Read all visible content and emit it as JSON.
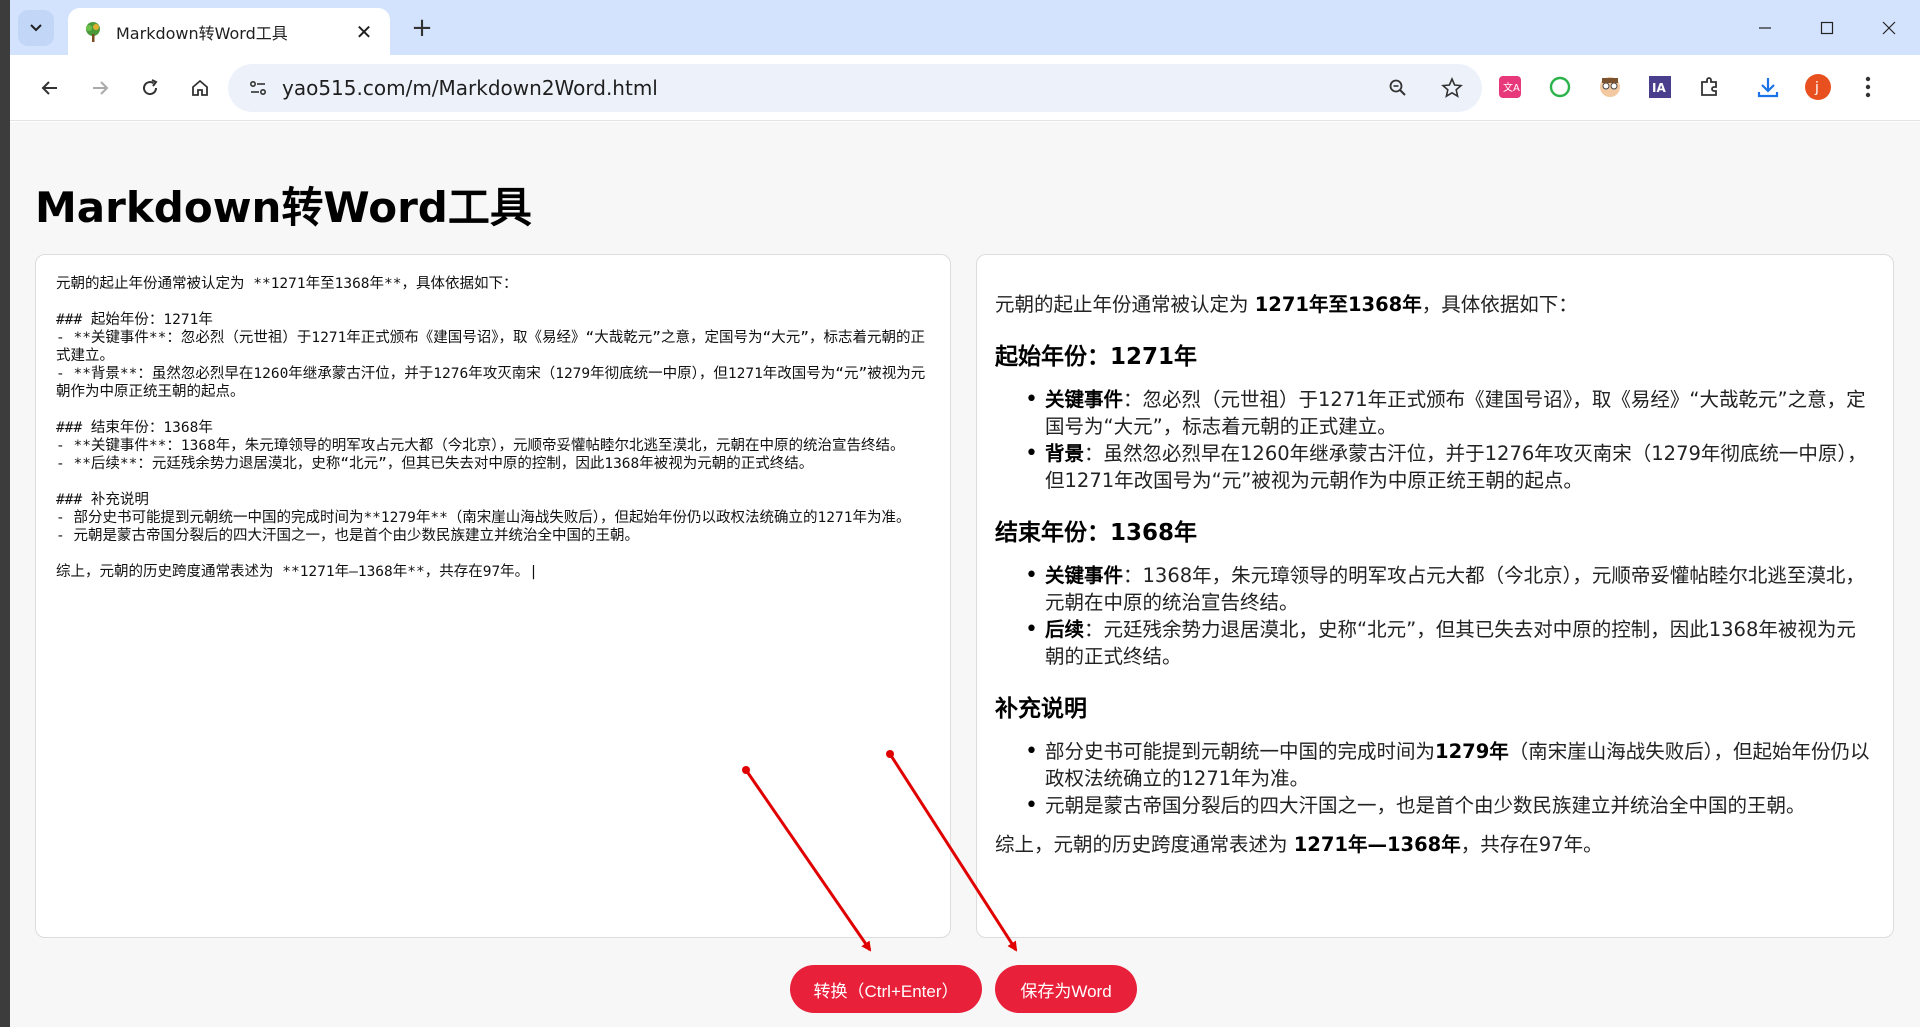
{
  "browser": {
    "tab_title": "Markdown转Word工具",
    "url": "yao515.com/m/Markdown2Word.html",
    "icons": [
      "tab-search-icon",
      "favicon-tree-icon",
      "close-icon",
      "plus-icon",
      "minimize-icon",
      "maximize-icon",
      "window-close-icon",
      "back-icon",
      "forward-icon",
      "reload-icon",
      "home-icon",
      "site-info-icon",
      "zoom-icon",
      "star-icon",
      "translate-ext-icon",
      "circle-ext-icon",
      "avatar-ext-icon",
      "ia-ext-icon",
      "puzzle-icon",
      "download-icon",
      "profile-icon",
      "more-icon"
    ],
    "ext_ia_label": "IA",
    "profile_initial": "j"
  },
  "page": {
    "title": "Markdown转Word工具",
    "markdown_source": "元朝的起止年份通常被认定为 **1271年至1368年**，具体依据如下：\n\n### 起始年份：1271年\n- **关键事件**：忽必烈（元世祖）于1271年正式颁布《建国号诏》，取《易经》“大哉乾元”之意，定国号为“大元”，标志着元朝的正式建立。\n- **背景**：虽然忽必烈早在1260年继承蒙古汗位，并于1276年攻灭南宋（1279年彻底统一中原），但1271年改国号为“元”被视为元朝作为中原正统王朝的起点。\n\n### 结束年份：1368年\n- **关键事件**：1368年，朱元璋领导的明军攻占元大都（今北京），元顺帝妥懽帖睦尔北逃至漠北，元朝在中原的统治宣告终结。\n- **后续**：元廷残余势力退居漠北，史称“北元”，但其已失去对中原的控制，因此1368年被视为元朝的正式终结。\n\n### 补充说明\n- 部分史书可能提到元朝统一中国的完成时间为**1279年**（南宋崖山海战失败后），但起始年份仍以政权法统确立的1271年为准。\n- 元朝是蒙古帝国分裂后的四大汗国之一，也是首个由少数民族建立并统治全中国的王朝。\n\n综上，元朝的历史跨度通常表述为 **1271年—1368年**，共存在97年。|",
    "preview": {
      "intro_pre": "元朝的起止年份通常被认定为 ",
      "intro_bold": "1271年至1368年",
      "intro_post": "，具体依据如下：",
      "h_start": "起始年份：1271年",
      "start_items": [
        {
          "bold": "关键事件",
          "text": "：忽必烈（元世祖）于1271年正式颁布《建国号诏》，取《易经》“大哉乾元”之意，定国号为“大元”，标志着元朝的正式建立。"
        },
        {
          "bold": "背景",
          "text": "：虽然忽必烈早在1260年继承蒙古汗位，并于1276年攻灭南宋（1279年彻底统一中原），但1271年改国号为“元”被视为元朝作为中原正统王朝的起点。"
        }
      ],
      "h_end": "结束年份：1368年",
      "end_items": [
        {
          "bold": "关键事件",
          "text": "：1368年，朱元璋领导的明军攻占元大都（今北京），元顺帝妥懽帖睦尔北逃至漠北，元朝在中原的统治宣告终结。"
        },
        {
          "bold": "后续",
          "text": "：元廷残余势力退居漠北，史称“北元”，但其已失去对中原的控制，因此1368年被视为元朝的正式终结。"
        }
      ],
      "h_extra": "补充说明",
      "extra_item1_pre": "部分史书可能提到元朝统一中国的完成时间为",
      "extra_item1_bold": "1279年",
      "extra_item1_post": "（南宋崖山海战失败后），但起始年份仍以政权法统确立的1271年为准。",
      "extra_item2": "元朝是蒙古帝国分裂后的四大汗国之一，也是首个由少数民族建立并统治全中国的王朝。",
      "summary_pre": "综上，元朝的历史跨度通常表述为 ",
      "summary_bold": "1271年—1368年",
      "summary_post": "，共存在97年。"
    },
    "buttons": {
      "convert": "转换（Ctrl+Enter）",
      "save": "保存为Word"
    },
    "annotation_color": "#e00000",
    "accent_color": "#e8203a"
  }
}
